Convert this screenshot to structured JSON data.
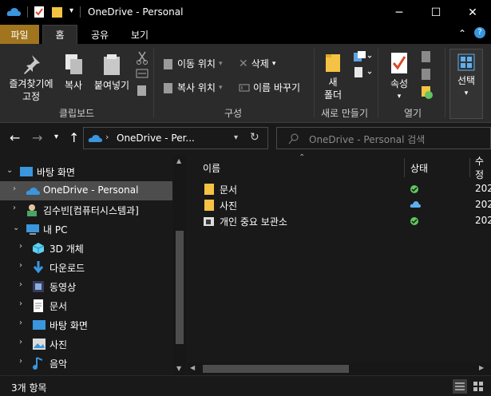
{
  "window": {
    "title": "OneDrive - Personal",
    "minimize": "─",
    "maximize": "☐",
    "close": "✕"
  },
  "ribbon_tabs": [
    {
      "label": "파일"
    },
    {
      "label": "홈"
    },
    {
      "label": "공유"
    },
    {
      "label": "보기"
    }
  ],
  "ribbon": {
    "clipboard": {
      "pin": "즐겨찾기에\n고정",
      "copy": "복사",
      "paste": "붙여넣기",
      "group": "클립보드"
    },
    "organize": {
      "move": "이동 위치",
      "copy_to": "복사 위치",
      "delete": "삭제",
      "rename": "이름 바꾸기",
      "group": "구성"
    },
    "new": {
      "new_folder": "새\n폴더",
      "group": "새로 만들기"
    },
    "open": {
      "properties": "속성",
      "group": "열기"
    },
    "select": {
      "select": "선택"
    }
  },
  "address": {
    "path": "OneDrive - Per...",
    "search_placeholder": "OneDrive - Personal 검색"
  },
  "tree": [
    {
      "label": "바탕 화면",
      "icon": "desktop-icon"
    },
    {
      "label": "OneDrive - Personal",
      "icon": "cloud-icon"
    },
    {
      "label": "김수빈[컴퓨터시스템과]",
      "icon": "user-icon"
    },
    {
      "label": "내 PC",
      "icon": "pc-icon"
    },
    {
      "label": "3D 개체",
      "icon": "cube-icon"
    },
    {
      "label": "다운로드",
      "icon": "download-icon"
    },
    {
      "label": "동영상",
      "icon": "video-icon"
    },
    {
      "label": "문서",
      "icon": "document-icon"
    },
    {
      "label": "바탕 화면",
      "icon": "desktop-icon"
    },
    {
      "label": "사진",
      "icon": "pictures-icon"
    },
    {
      "label": "음악",
      "icon": "music-icon"
    }
  ],
  "columns": {
    "name": "이름",
    "status": "상태",
    "modified": "수정"
  },
  "files": [
    {
      "name": "문서",
      "status": "synced",
      "date": "202"
    },
    {
      "name": "사진",
      "status": "cloud",
      "date": "202"
    },
    {
      "name": "개인 중요 보관소",
      "status": "synced",
      "date": "202"
    }
  ],
  "status": {
    "count": "3개 항목"
  },
  "colors": {
    "accent_file_tab": "#a0751e",
    "sync_green": "#5fc65f",
    "cloud_blue": "#5fb0f0",
    "folder_yellow": "#f5c343"
  }
}
